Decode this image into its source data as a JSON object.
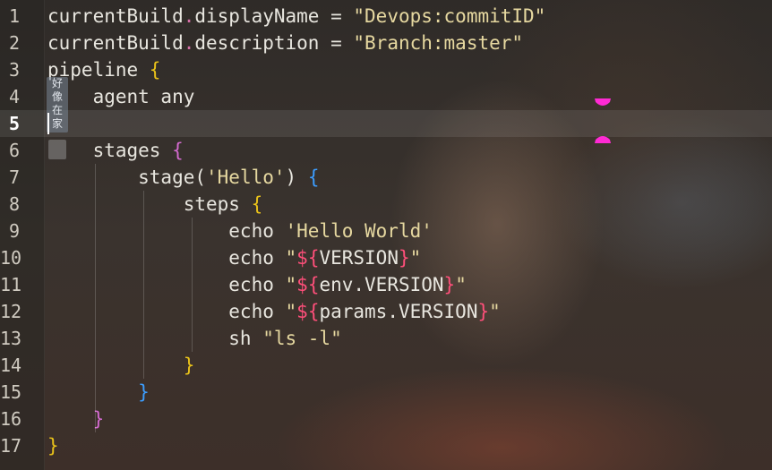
{
  "editor": {
    "active_line": 5,
    "line_numbers": [
      "1",
      "2",
      "3",
      "4",
      "5",
      "6",
      "7",
      "8",
      "9",
      "10",
      "11",
      "12",
      "13",
      "14",
      "15",
      "16",
      "17"
    ],
    "lines": [
      [
        {
          "t": "currentBuild",
          "c": "ident"
        },
        {
          "t": ".",
          "c": "dot"
        },
        {
          "t": "displayName = ",
          "c": "ident"
        },
        {
          "t": "\"Devops:commitID\"",
          "c": "str"
        }
      ],
      [
        {
          "t": "currentBuild",
          "c": "ident"
        },
        {
          "t": ".",
          "c": "dot"
        },
        {
          "t": "description = ",
          "c": "ident"
        },
        {
          "t": "\"Branch:master\"",
          "c": "str"
        }
      ],
      [
        {
          "t": "pipeline ",
          "c": "ident"
        },
        {
          "t": "{",
          "c": "b1"
        }
      ],
      [
        {
          "t": "    agent any",
          "c": "ident"
        }
      ],
      [],
      [
        {
          "t": "    stages ",
          "c": "ident"
        },
        {
          "t": "{",
          "c": "b2"
        }
      ],
      [
        {
          "t": "        stage(",
          "c": "ident"
        },
        {
          "t": "'Hello'",
          "c": "str"
        },
        {
          "t": ") ",
          "c": "ident"
        },
        {
          "t": "{",
          "c": "b3"
        }
      ],
      [
        {
          "t": "            steps ",
          "c": "ident"
        },
        {
          "t": "{",
          "c": "b1"
        }
      ],
      [
        {
          "t": "                echo ",
          "c": "ident"
        },
        {
          "t": "'Hello World'",
          "c": "str"
        }
      ],
      [
        {
          "t": "                echo ",
          "c": "ident"
        },
        {
          "t": "\"",
          "c": "str"
        },
        {
          "t": "${",
          "c": "interp"
        },
        {
          "t": "VERSION",
          "c": "ident"
        },
        {
          "t": "}",
          "c": "interp"
        },
        {
          "t": "\"",
          "c": "str"
        }
      ],
      [
        {
          "t": "                echo ",
          "c": "ident"
        },
        {
          "t": "\"",
          "c": "str"
        },
        {
          "t": "${",
          "c": "interp"
        },
        {
          "t": "env.VERSION",
          "c": "ident"
        },
        {
          "t": "}",
          "c": "interp"
        },
        {
          "t": "\"",
          "c": "str"
        }
      ],
      [
        {
          "t": "                echo ",
          "c": "ident"
        },
        {
          "t": "\"",
          "c": "str"
        },
        {
          "t": "${",
          "c": "interp"
        },
        {
          "t": "params.VERSION",
          "c": "ident"
        },
        {
          "t": "}",
          "c": "interp"
        },
        {
          "t": "\"",
          "c": "str"
        }
      ],
      [
        {
          "t": "                sh ",
          "c": "ident"
        },
        {
          "t": "\"ls -l\"",
          "c": "str"
        }
      ],
      [
        {
          "t": "            }",
          "c": "b1"
        }
      ],
      [
        {
          "t": "        }",
          "c": "b3"
        }
      ],
      [
        {
          "t": "    }",
          "c": "b2"
        }
      ],
      [
        {
          "t": "}",
          "c": "b1"
        }
      ]
    ]
  },
  "sticker": {
    "text": [
      "好",
      "像",
      "在",
      "家"
    ]
  },
  "colors": {
    "string": "#e6d8a0",
    "interpolation": "#ff4f7a",
    "bracket_level1": "#e9c21a",
    "bracket_level2": "#d46ad0",
    "bracket_level3": "#3c9dff",
    "marker": "#ff2ad4"
  },
  "icons": [
    "bookmark-marker-icon",
    "sticker-icon"
  ]
}
